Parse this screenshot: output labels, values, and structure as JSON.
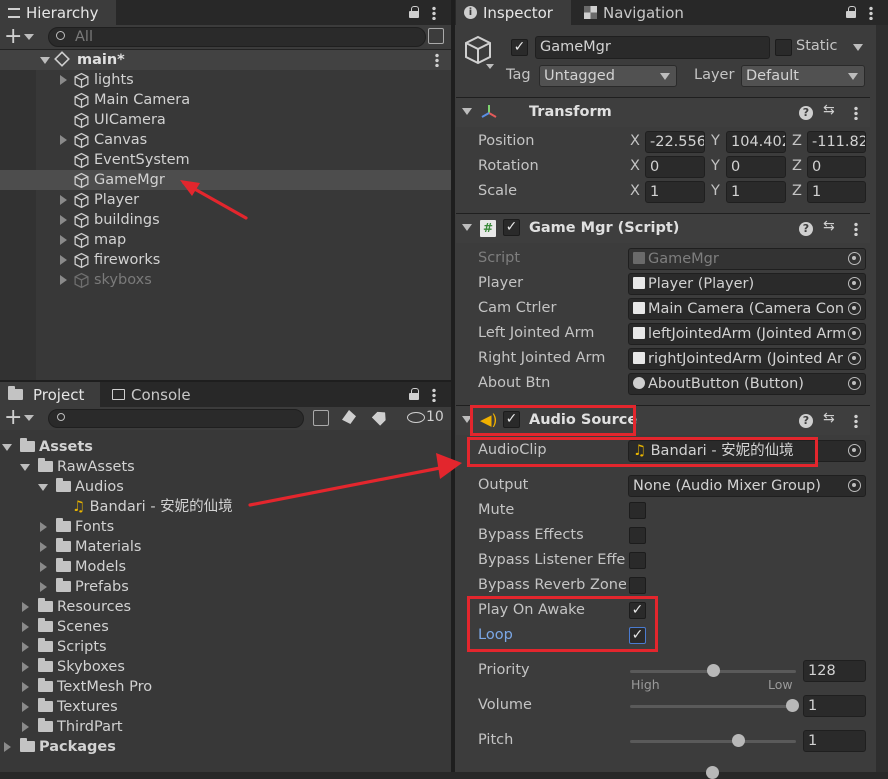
{
  "hierarchy": {
    "tab": "Hierarchy",
    "search_placeholder": "All",
    "scene": "main*",
    "items": [
      {
        "label": "lights",
        "expandable": true
      },
      {
        "label": "Main Camera",
        "expandable": false
      },
      {
        "label": "UICamera",
        "expandable": false
      },
      {
        "label": "Canvas",
        "expandable": true
      },
      {
        "label": "EventSystem",
        "expandable": false
      },
      {
        "label": "GameMgr",
        "expandable": false,
        "selected": true
      },
      {
        "label": "Player",
        "expandable": true
      },
      {
        "label": "buildings",
        "expandable": true
      },
      {
        "label": "map",
        "expandable": true
      },
      {
        "label": "fireworks",
        "expandable": true
      },
      {
        "label": "skyboxs",
        "expandable": true,
        "disabled": true
      }
    ]
  },
  "project": {
    "tab_project": "Project",
    "tab_console": "Console",
    "hidden_count": "10",
    "assets": "Assets",
    "raw_assets": "RawAssets",
    "audios": "Audios",
    "audio_file": "Bandari - 安妮的仙境",
    "raw_children": [
      "Fonts",
      "Materials",
      "Models",
      "Prefabs"
    ],
    "asset_children": [
      "Resources",
      "Scenes",
      "Scripts",
      "Skyboxes",
      "TextMesh Pro",
      "Textures",
      "ThirdPart"
    ],
    "packages": "Packages"
  },
  "inspector": {
    "tab_inspector": "Inspector",
    "tab_navigation": "Navigation",
    "object_name": "GameMgr",
    "static_label": "Static",
    "tag_label": "Tag",
    "tag_value": "Untagged",
    "layer_label": "Layer",
    "layer_value": "Default",
    "transform": {
      "title": "Transform",
      "position_label": "Position",
      "rotation_label": "Rotation",
      "scale_label": "Scale",
      "position": {
        "x": "-22.556",
        "y": "104.402",
        "z": "-111.82"
      },
      "rotation": {
        "x": "0",
        "y": "0",
        "z": "0"
      },
      "scale": {
        "x": "1",
        "y": "1",
        "z": "1"
      }
    },
    "script": {
      "title": "Game Mgr (Script)",
      "fields": [
        {
          "label": "Script",
          "value": "GameMgr"
        },
        {
          "label": "Player",
          "value": "Player (Player)"
        },
        {
          "label": "Cam Ctrler",
          "value": "Main Camera (Camera Con"
        },
        {
          "label": "Left Jointed Arm",
          "value": "leftJointedArm (Jointed Arm"
        },
        {
          "label": "Right Jointed Arm",
          "value": "rightJointedArm (Jointed Ar"
        },
        {
          "label": "About Btn",
          "value": "AboutButton (Button)"
        }
      ]
    },
    "audio": {
      "title": "Audio Source",
      "audioclip_label": "AudioClip",
      "audioclip_value": "Bandari - 安妮的仙境",
      "output_label": "Output",
      "output_value": "None (Audio Mixer Group)",
      "mute": "Mute",
      "bypass_effects": "Bypass Effects",
      "bypass_listener": "Bypass Listener Effe",
      "bypass_reverb": "Bypass Reverb Zone",
      "play_on_awake": "Play On Awake",
      "loop": "Loop",
      "priority_label": "Priority",
      "priority_value": "128",
      "priority_fraction": 0.5,
      "high": "High",
      "low": "Low",
      "volume_label": "Volume",
      "volume_value": "1",
      "pitch_label": "Pitch",
      "pitch_value": "1"
    }
  },
  "colors": {
    "accent_red": "#e3262d",
    "selection": "#4d4d4d",
    "link_blue": "#7ba7e6"
  }
}
